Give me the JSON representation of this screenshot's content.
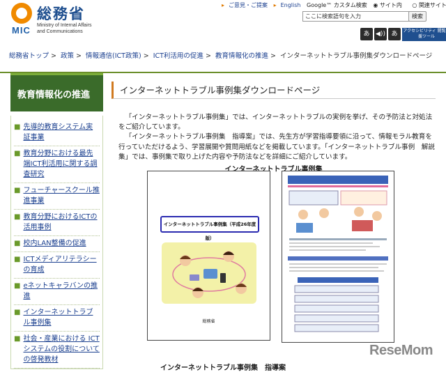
{
  "header": {
    "logo_jp": "総務省",
    "logo_mic": "MIC",
    "logo_en": "Ministry of Internal Affairs\nand Communications",
    "top_links": [
      "ご意見・ご提案",
      "English",
      "Google™ カスタム検索",
      "サイト内",
      "関連サイト"
    ],
    "search_placeholder": "ここに検索語句を入力",
    "search_button": "検索",
    "accessibility": [
      "あ",
      "◀))",
      "あ"
    ],
    "accessibility_tool": "アクセシビリティ 閲覧支援ツール"
  },
  "breadcrumb": [
    "総務省トップ",
    "政策",
    "情報通信(ICT政策)",
    "ICT利活用の促進",
    "教育情報化の推進",
    "インターネットトラブル事例集ダウンロードページ"
  ],
  "breadcrumb_sep": ">",
  "sidebar": {
    "heading": "教育情報化の推進",
    "items": [
      "先導的教育システム実証事業",
      "教育分野における最先端ICT利活用に関する調査研究",
      "フューチャースクール推進事業",
      "教育分野におけるICTの活用事例",
      "校内LAN整備の促進",
      "ICTメディアリテラシーの育成",
      "eネットキャラバンの推進",
      "インターネットトラブル事例集",
      "社会・産業における ICTシステムの役割についての啓発教材"
    ]
  },
  "main": {
    "title": "インターネットトラブル事例集ダウンロードページ",
    "paragraphs": [
      "「インターネットトラブル事例集」では、インターネットトラブルの実例を挙げ、その予防法と対処法をご紹介しています。",
      "「インターネットトラブル事例集　指導案」では、先生方が学習指導要領に沿って、情報モラル教育を行っていただけるよう、学習展開や質問用紙などを掲載しています。「インターネットトラブル事例　解説集」では、事例集で取り上げた内容や予防法などを詳細にご紹介しています。"
    ],
    "figure_title": "インターネットトラブル事例集",
    "doc1_title": "インターネットトラブル事例集（平成26年度版）",
    "doc1_footer": "総務省",
    "footer_caption": "インターネットトラブル事例集　指導案"
  },
  "watermark": "ReseMom",
  "colors": {
    "green_dark": "#3a6b2a",
    "green_light": "#7cae3a",
    "orange": "#f08a00",
    "link": "#1a3f8f"
  }
}
